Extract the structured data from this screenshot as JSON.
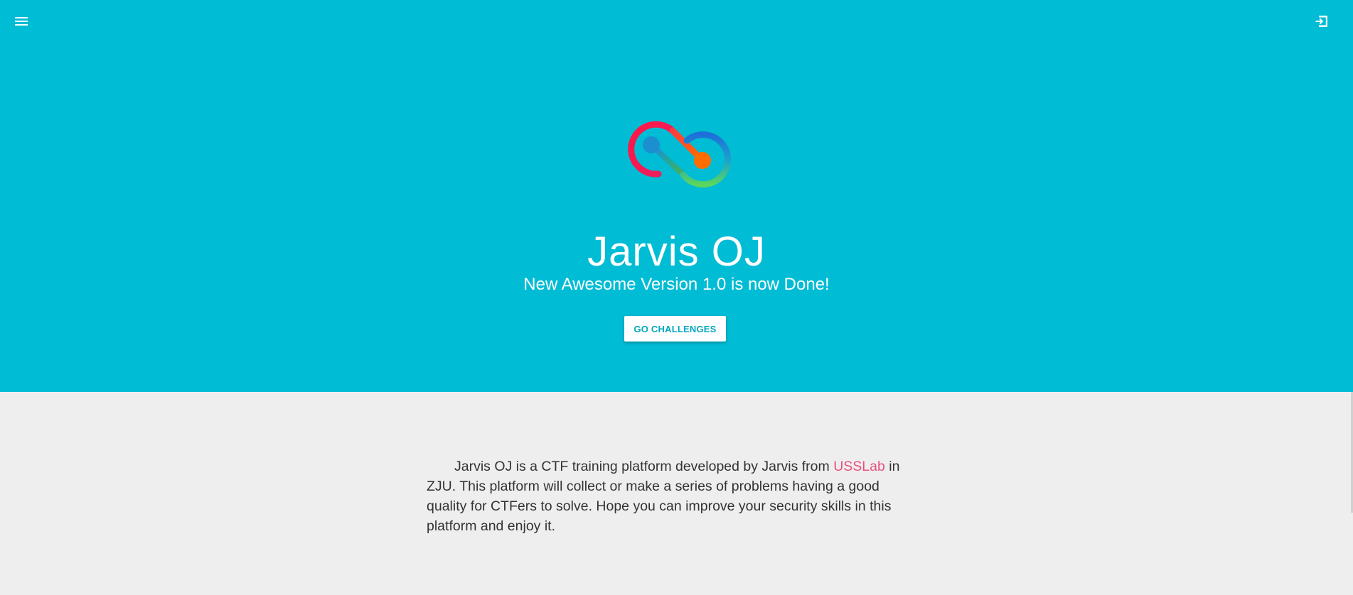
{
  "header": {
    "menu_icon": "hamburger-menu-icon",
    "login_icon": "login-icon"
  },
  "hero": {
    "title": "Jarvis OJ",
    "subtitle": "New Awesome Version 1.0 is now Done!",
    "cta_label": "GO CHALLENGES",
    "background_color": "#00bcd4",
    "cta_text_color": "#00a7bf"
  },
  "about": {
    "text_before_link": "Jarvis OJ is a CTF training platform developed by Jarvis from ",
    "link_text": "USSLab",
    "text_after_link": " in ZJU. This platform will collect or make a series of problems having a good quality for CTFers to solve. Hope you can improve your security skills in this platform and enjoy it.",
    "link_color": "#e9507f"
  }
}
